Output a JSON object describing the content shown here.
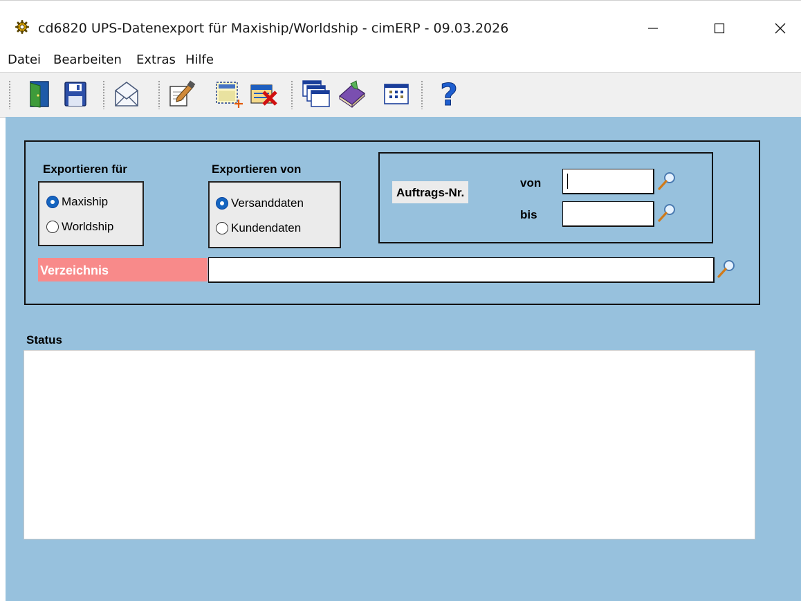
{
  "window": {
    "title": "cd6820 UPS-Datenexport für Maxiship/Worldship - cimERP - 09.03.2026",
    "app_icon": "gear-icon",
    "controls": [
      "minimize-icon",
      "maximize-icon",
      "close-icon"
    ]
  },
  "menu": {
    "items": [
      {
        "label": "Datei"
      },
      {
        "label": "Bearbeiten"
      },
      {
        "label": "Extras"
      },
      {
        "label": "Hilfe"
      }
    ]
  },
  "toolbar": {
    "buttons": [
      "exit-door-icon",
      "save-disk-icon",
      "email-envelope-icon",
      "edit-document-icon",
      "new-record-icon",
      "delete-record-icon",
      "windows-cascade-icon",
      "book-icon",
      "grid-table-icon",
      "help-question-icon"
    ]
  },
  "form": {
    "export_for": {
      "label": "Exportieren für",
      "options": [
        {
          "label": "Maxiship",
          "selected": true
        },
        {
          "label": "Worldship",
          "selected": false
        }
      ]
    },
    "export_from": {
      "label": "Exportieren von",
      "options": [
        {
          "label": "Versanddaten",
          "selected": true
        },
        {
          "label": "Kundendaten",
          "selected": false
        }
      ]
    },
    "order_no": {
      "label": "Auftrags-Nr.",
      "from_label": "von",
      "from_value": "",
      "to_label": "bis",
      "to_value": ""
    },
    "directory": {
      "label": "Verzeichnis",
      "value": ""
    }
  },
  "status": {
    "label": "Status",
    "text": ""
  },
  "colors": {
    "content_bg": "#97c1dd",
    "required_label_bg": "#f88a8a",
    "radio_selected": "#1565c0"
  }
}
